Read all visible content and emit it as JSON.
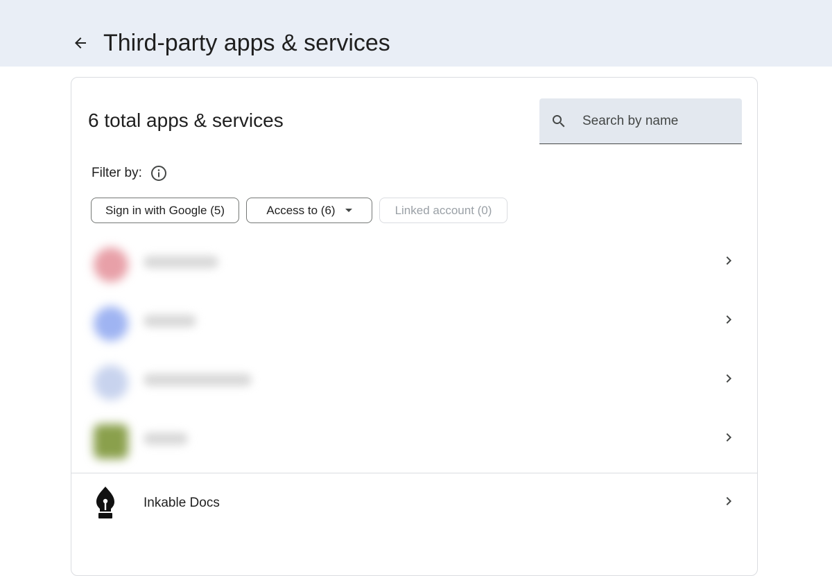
{
  "header": {
    "back_label": "Back",
    "title": "Third-party apps & services"
  },
  "summary": {
    "total_label": "6 total apps & services"
  },
  "search": {
    "placeholder": "Search by name",
    "value": ""
  },
  "filters": {
    "label": "Filter by:",
    "chips": [
      {
        "label": "Sign in with Google (5)",
        "enabled": true
      },
      {
        "label": "Access to (6)",
        "enabled": true,
        "has_dropdown": true
      },
      {
        "label": "Linked account (0)",
        "enabled": false
      }
    ]
  },
  "apps": [
    {
      "name": "",
      "redacted": true,
      "icon_color": "#e8a0a8"
    },
    {
      "name": "",
      "redacted": true,
      "icon_color": "#9fb4f2"
    },
    {
      "name": "",
      "redacted": true,
      "icon_color": "#c8d3ee"
    },
    {
      "name": "",
      "redacted": true,
      "icon_color": "#8aa04c"
    },
    {
      "name": "Inkable Docs",
      "redacted": false,
      "icon": "pen-nib-icon"
    }
  ],
  "colors": {
    "header_bg": "#e9eef6",
    "search_bg": "#e3e8ef",
    "disabled_text": "#9aa0a6"
  }
}
